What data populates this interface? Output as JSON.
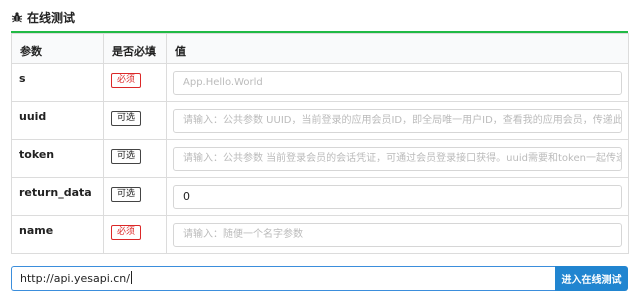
{
  "section": {
    "title": "在线测试",
    "icon": "bug-icon"
  },
  "table": {
    "headers": [
      "参数",
      "是否必填",
      "值"
    ],
    "rows": [
      {
        "name": "s",
        "required_label": "必须",
        "required": true,
        "value": "",
        "placeholder": "App.Hello.World"
      },
      {
        "name": "uuid",
        "required_label": "可选",
        "required": false,
        "value": "",
        "placeholder": "请输入：公共参数 UUID，当前登录的应用会员ID，即全局唯一用户ID，查看我的应用会员，传递此参数后，"
      },
      {
        "name": "token",
        "required_label": "可选",
        "required": false,
        "value": "",
        "placeholder": "请输入：公共参数 当前登录会员的会话凭证，可通过会员登录接口获得。uuid需要和token一起传递。"
      },
      {
        "name": "return_data",
        "required_label": "可选",
        "required": false,
        "value": "0",
        "placeholder": ""
      },
      {
        "name": "name",
        "required_label": "必须",
        "required": true,
        "value": "",
        "placeholder": "请输入：随便一个名字参数"
      }
    ]
  },
  "request": {
    "url": "http://api.yesapi.cn/",
    "submit_label": "进入在线测试"
  },
  "colors": {
    "accent_green": "#21ba45",
    "required_red": "#db2828",
    "primary_blue": "#2185d0"
  }
}
